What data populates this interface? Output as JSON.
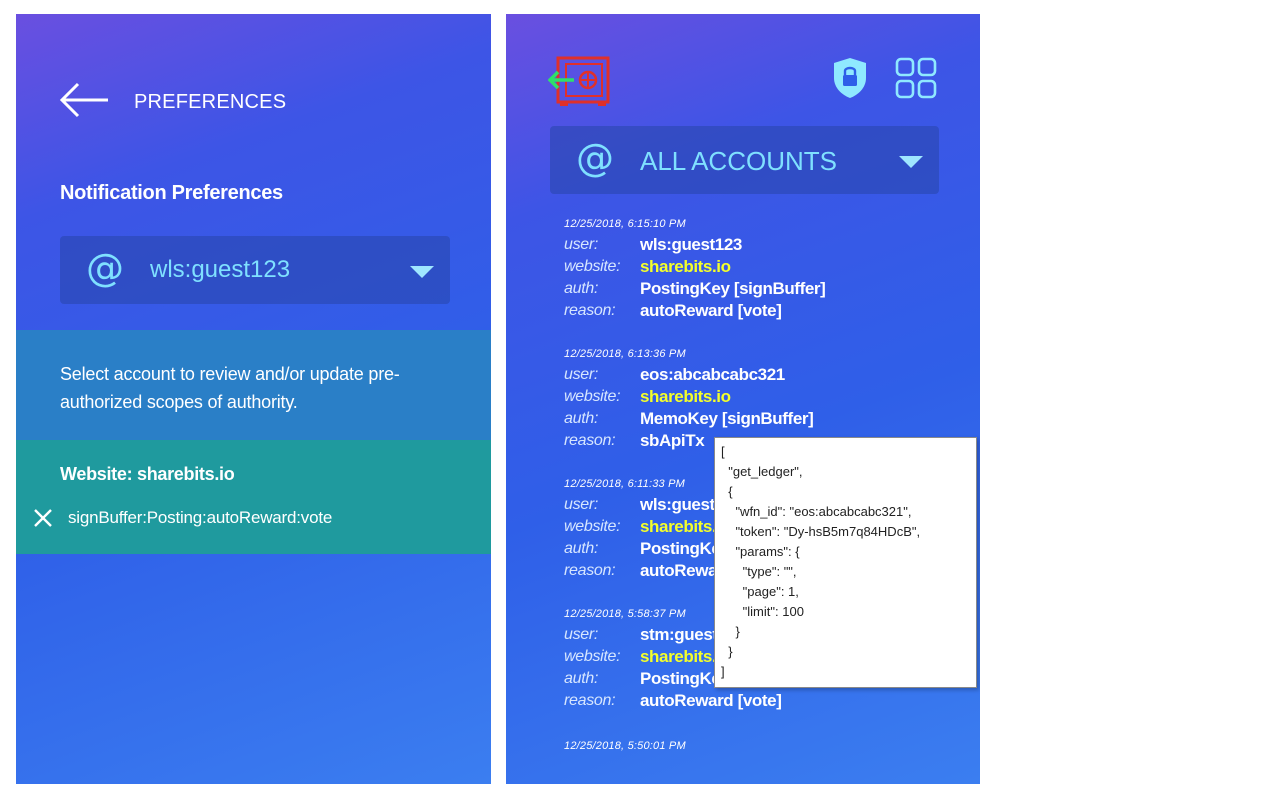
{
  "preferences": {
    "title": "PREFERENCES",
    "section_title": "Notification Preferences",
    "account_select": {
      "value": "wls:guest123"
    },
    "info_text": "Select account to review and/or update pre-authorized scopes of authority.",
    "scope_group": {
      "website_label": "Website: sharebits.io",
      "scopes": [
        "signBuffer:Posting:autoReward:vote"
      ]
    }
  },
  "log_panel": {
    "account_filter": "ALL ACCOUNTS",
    "labels": {
      "user": "user:",
      "website": "website:",
      "auth": "auth:",
      "reason": "reason:"
    },
    "entries": [
      {
        "timestamp": "12/25/2018, 6:15:10 PM",
        "user": "wls:guest123",
        "website": "sharebits.io",
        "auth": "PostingKey [signBuffer]",
        "reason": "autoReward [vote]"
      },
      {
        "timestamp": "12/25/2018, 6:13:36 PM",
        "user": "eos:abcabcabc321",
        "website": "sharebits.io",
        "auth": "MemoKey [signBuffer]",
        "reason": "sbApiTx"
      },
      {
        "timestamp": "12/25/2018, 6:11:33 PM",
        "user": "wls:guest",
        "website": "sharebits.io",
        "auth": "PostingKey",
        "reason": "autoReward"
      },
      {
        "timestamp": "12/25/2018, 5:58:37 PM",
        "user": "stm:guest",
        "website": "sharebits.io",
        "auth": "PostingKey [signBuffer]",
        "reason": "autoReward [vote]"
      },
      {
        "timestamp": "12/25/2018, 5:50:01 PM"
      }
    ],
    "tooltip_lines": [
      "[",
      "  \"get_ledger\",",
      "  {",
      "    \"wfn_id\": \"eos:abcabcabc321\",",
      "    \"token\": \"Dy-hsB5m7q84HDcB\",",
      "    \"params\": {",
      "      \"type\": \"\",",
      "      \"page\": 1,",
      "      \"limit\": 100",
      "    }",
      "  }",
      "]"
    ]
  },
  "colors": {
    "accent_cyan": "#7fe0ff",
    "website_yellow": "#f4ff2a",
    "info_band": "#2a7fc7",
    "scope_band": "#1f9a9e",
    "vault_red": "#e0302a"
  },
  "icons": [
    "back-arrow-icon",
    "at-icon",
    "dropdown-triangle-icon",
    "close-icon",
    "vault-exit-icon",
    "shield-lock-icon",
    "grid-icon"
  ]
}
